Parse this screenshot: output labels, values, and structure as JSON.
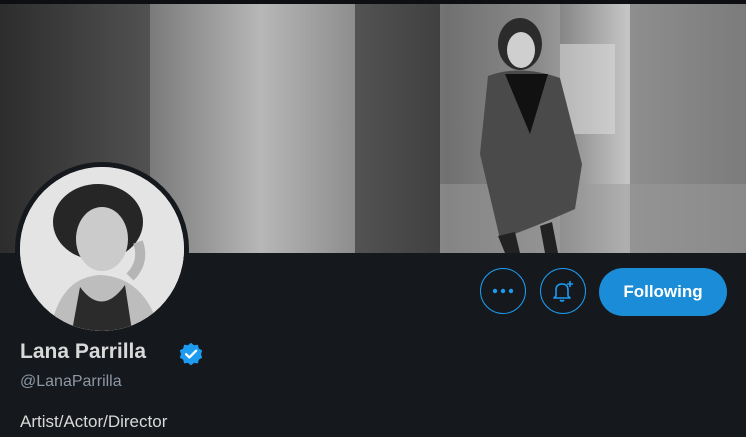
{
  "profile": {
    "name": "Lana Parrilla",
    "handle": "@LanaParrilla",
    "bio": "Artist/Actor/Director"
  },
  "actions": {
    "follow_label": "Following",
    "more_icon": "more-icon",
    "notify_icon": "bell-plus-icon"
  },
  "colors": {
    "accent": "#1a8cd8",
    "verified": "#1d9bf0",
    "background": "#15181c"
  }
}
